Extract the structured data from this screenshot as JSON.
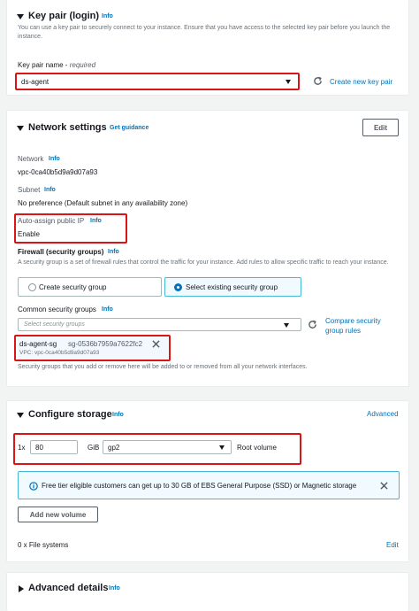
{
  "key_pair": {
    "title": "Key pair (login)",
    "info": "Info",
    "description": "You can use a key pair to securely connect to your instance. Ensure that you have access to the selected key pair before you launch the instance.",
    "field_label": "Key pair name - ",
    "field_required": "required",
    "selected_value": "ds-agent",
    "create_link": "Create new key pair"
  },
  "network": {
    "title": "Network settings",
    "guidance_link": "Get guidance",
    "edit_label": "Edit",
    "network_label": "Network",
    "network_info": "Info",
    "network_value": "vpc-0ca40b5d9a9d07a93",
    "subnet_label": "Subnet",
    "subnet_info": "Info",
    "subnet_value": "No preference (Default subnet in any availability zone)",
    "public_ip_label": "Auto-assign public IP",
    "public_ip_info": "Info",
    "public_ip_value": "Enable",
    "firewall_title": "Firewall (security groups)",
    "firewall_info": "Info",
    "firewall_description": "A security group is a set of firewall rules that control the traffic for your instance. Add rules to allow specific traffic to reach your instance.",
    "create_sg_option": "Create security group",
    "select_sg_option": "Select existing security group",
    "common_sg_label": "Common security groups",
    "common_sg_info": "Info",
    "sg_placeholder": "Select security groups",
    "compare_link_line1": "Compare security",
    "compare_link_line2": "group rules",
    "token_name": "ds-agent-sg",
    "token_id": "sg-0536b7959a7622fc2",
    "token_vpc": "VPC: vpc-0ca40b5d9a9d07a93",
    "sg_hint": "Security groups that you add or remove here will be added to or removed from all your network interfaces."
  },
  "storage": {
    "title": "Configure storage",
    "info": "Info",
    "advanced_link": "Advanced",
    "count_label": "1x",
    "size_value": "80",
    "unit_label": "GiB",
    "volume_type": "gp2",
    "volume_label": "Root volume",
    "alert_text": "Free tier eligible customers can get up to 30 GB of EBS General Purpose (SSD) or Magnetic storage",
    "add_volume_label": "Add new volume",
    "filesystems_label": "0 x File systems",
    "edit_link": "Edit"
  },
  "advanced": {
    "title": "Advanced details",
    "info": "Info"
  },
  "colors": {
    "link": "#0073bb",
    "highlight": "#d91515",
    "alert_bg": "#f1faff",
    "alert_border": "#44b9d6"
  }
}
